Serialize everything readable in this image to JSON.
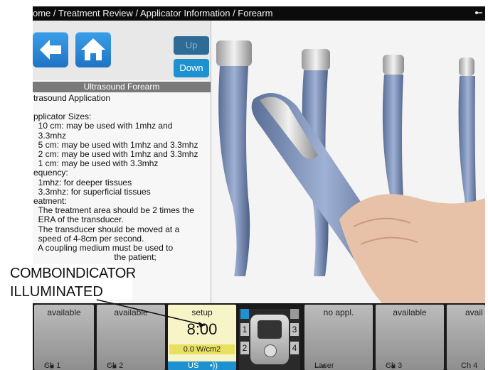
{
  "breadcrumb": "ome / Treatment Review / Applicator Information / Forearm",
  "nav": {
    "up_label": "Up",
    "down_label": "Down"
  },
  "panel": {
    "title": "Ultrasound Forearm",
    "lines": [
      "trasound Application",
      "",
      "pplicator Sizes:",
      "  10 cm: may be used with 1mhz and",
      "  3.3mhz",
      "  5 cm: may be used with 1mhz and 3.3mhz",
      "  2 cm: may be used with 1mhz and 3.3mhz",
      "  1 cm: may be used with 3.3mhz",
      "equency:",
      "  1mhz: for deeper tissues",
      "  3.3mhz: for superficial tissues",
      "eatment:",
      "  The treatment area should be 2 times the",
      "  ERA of the transducer.",
      "  The transducer should be moved at a",
      "  speed of 4-8cm per second.",
      "  A coupling medium must be used to",
      "                                  the patient;"
    ]
  },
  "channels": {
    "ch1": {
      "status": "available",
      "label": "Ch 1"
    },
    "ch2": {
      "status": "available",
      "label": "Ch 2"
    },
    "active": {
      "status": "setup",
      "time": "8:00",
      "intensity": "0.0 W/cm2",
      "mode": "US"
    },
    "combo_numbers": [
      "1",
      "2",
      "3",
      "4"
    ],
    "laser": {
      "status": "no appl.",
      "label": "Laser"
    },
    "ch3": {
      "status": "available",
      "label": "Ch 3"
    },
    "ch4": {
      "status": "avail",
      "label": "Ch 4"
    }
  },
  "callout": {
    "line1": "COMBOINDICATOR",
    "line2": "ILLUMINATED"
  },
  "colors": {
    "accent_blue": "#1e92d0",
    "active_channel": "#f7f4c8",
    "intensity_bar": "#e8e060"
  }
}
